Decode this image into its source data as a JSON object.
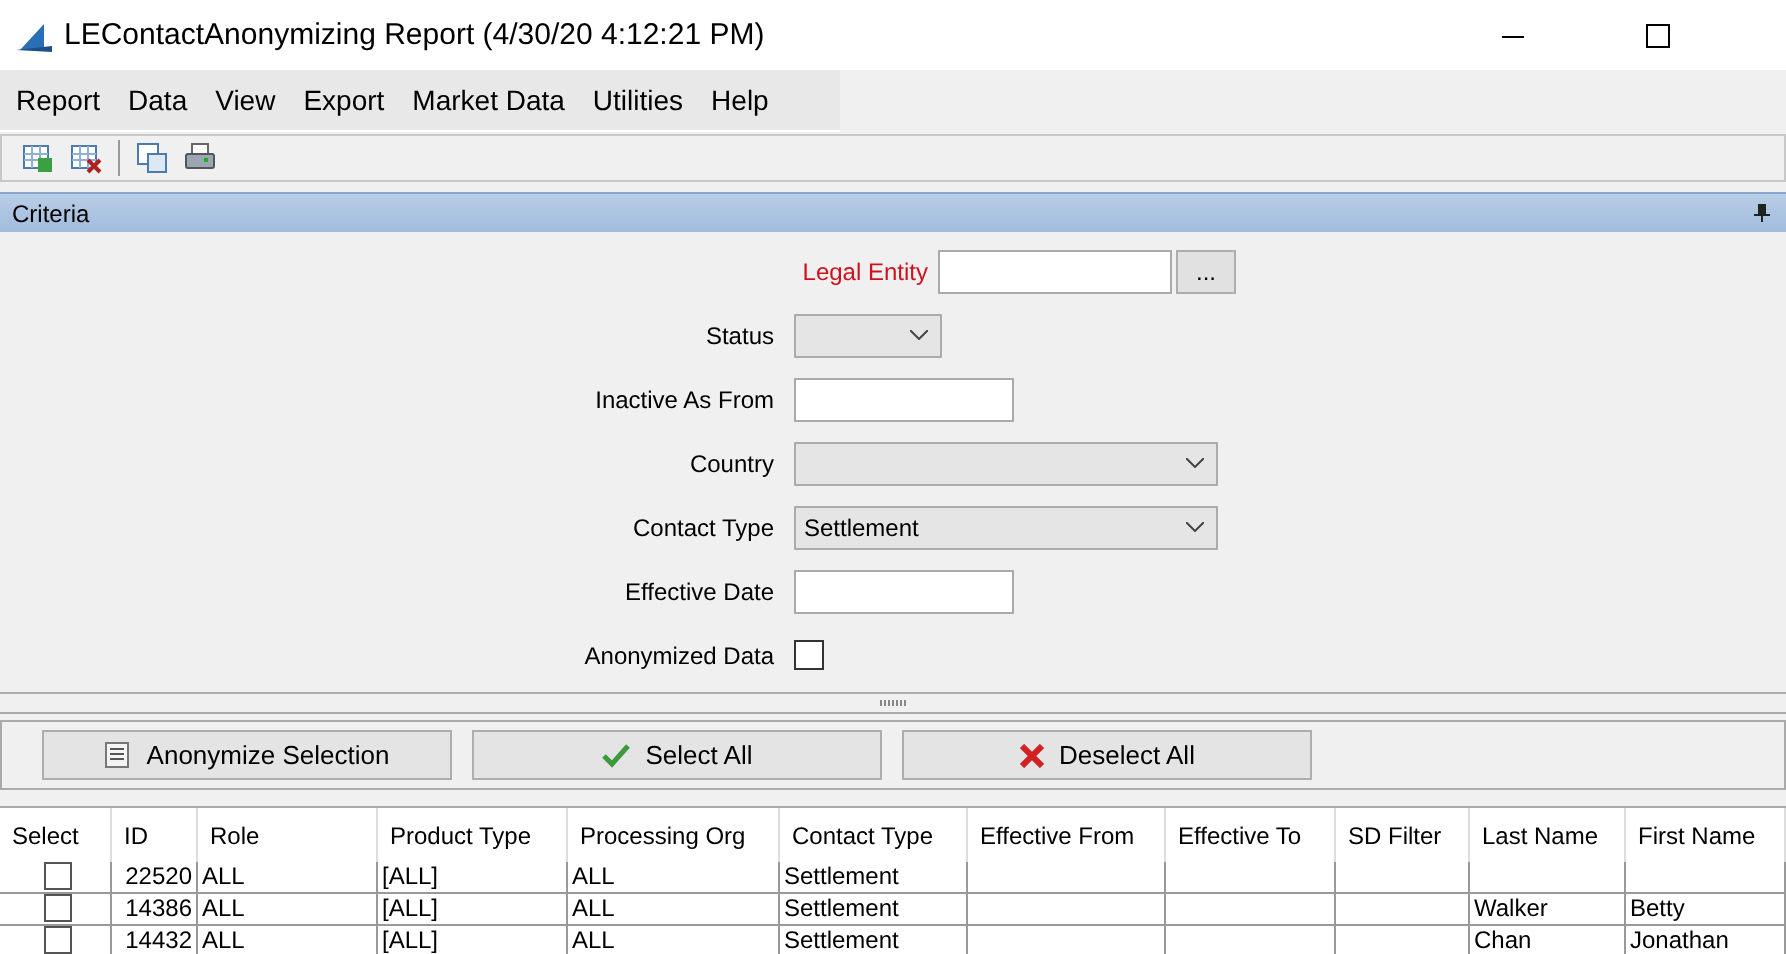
{
  "window": {
    "title": "LEContactAnonymizing Report (4/30/20 4:12:21 PM)"
  },
  "menu": [
    "Report",
    "Data",
    "View",
    "Export",
    "Market Data",
    "Utilities",
    "Help"
  ],
  "criteria": {
    "title": "Criteria",
    "fields": [
      {
        "kind": "lookup",
        "label": "Legal Entity",
        "required": true,
        "button": "..."
      },
      {
        "kind": "short_select",
        "label": "Status",
        "required": false
      },
      {
        "kind": "date",
        "label": "Inactive As From",
        "required": false
      },
      {
        "kind": "select",
        "label": "Country",
        "required": false
      },
      {
        "kind": "select",
        "label": "Contact Type",
        "required": false,
        "value": "Settlement"
      },
      {
        "kind": "date",
        "label": "Effective Date",
        "required": false
      },
      {
        "kind": "checkbox",
        "label": "Anonymized Data",
        "required": false,
        "checked": false
      }
    ]
  },
  "actions": [
    {
      "kind": "list",
      "label": "Anonymize Selection"
    },
    {
      "kind": "check",
      "label": "Select All"
    },
    {
      "kind": "cross",
      "label": "Deselect All"
    }
  ],
  "table": {
    "columns": [
      "Select",
      "ID",
      "Role",
      "Product Type",
      "Processing Org",
      "Contact Type",
      "Effective From",
      "Effective To",
      "SD Filter",
      "Last Name",
      "First Name"
    ],
    "rows": [
      {
        "checked": false,
        "cells": [
          "",
          "22520",
          "ALL",
          "[ALL]",
          "ALL",
          "Settlement",
          "",
          "",
          "",
          "",
          ""
        ]
      },
      {
        "checked": false,
        "cells": [
          "",
          "14386",
          "ALL",
          "[ALL]",
          "ALL",
          "Settlement",
          "",
          "",
          "",
          "Walker",
          "Betty"
        ]
      },
      {
        "checked": false,
        "cells": [
          "",
          "14432",
          "ALL",
          "[ALL]",
          "ALL",
          "Settlement",
          "",
          "",
          "",
          "Chan",
          "Jonathan"
        ]
      }
    ]
  }
}
